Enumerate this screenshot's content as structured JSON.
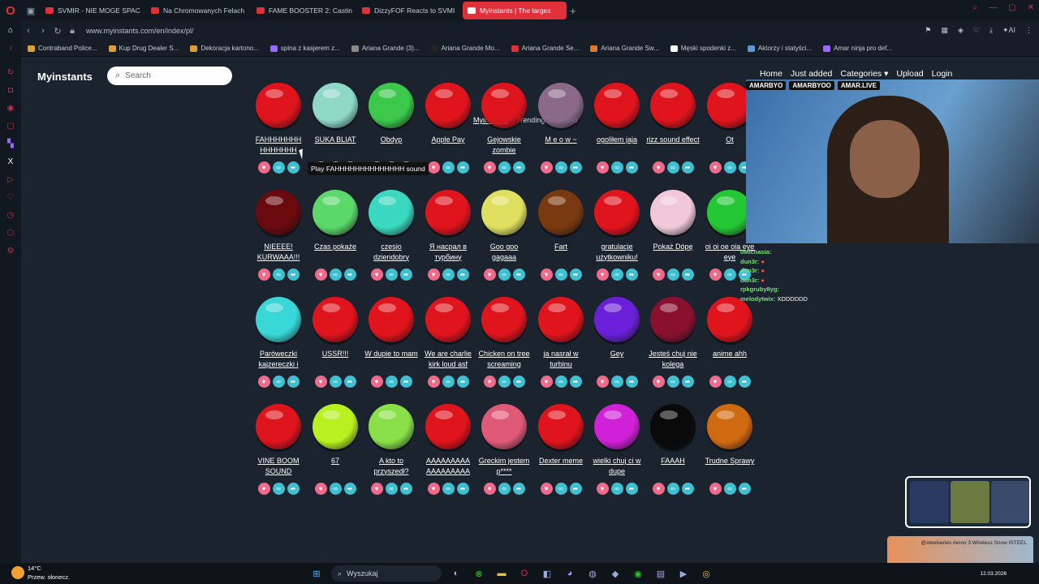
{
  "browser": {
    "tabs": [
      {
        "label": "SVMIR - NIE MOGE SPAC",
        "active": false
      },
      {
        "label": "Na Chromowanych Felach",
        "active": false
      },
      {
        "label": "FAME BOOSTER 2: Castin",
        "active": false
      },
      {
        "label": "DizzyFOF Reacts to SVMI",
        "active": false
      },
      {
        "label": "Myinstants | The larges",
        "active": true
      }
    ],
    "url": "www.myinstants.com/en/index/pl/",
    "bookmarks": [
      "Contraband Police...",
      "Kup Drug Dealer S...",
      "Dekoracja kartono...",
      "spina z kasjerem z...",
      "Ariana Grande (3)...",
      "Ariana Grande Mo...",
      "Ariana Grande Se...",
      "Ariana Grande Sw...",
      "Męski spodenki z...",
      "Aktorzy i statyści...",
      "Amar ninja pro def..."
    ]
  },
  "site": {
    "brand": "Myinstants",
    "search_placeholder": "Search",
    "nav": [
      "Home",
      "Just added",
      "Categories ▾",
      "Upload",
      "Login"
    ],
    "breadcrumb_root": "Myinstants",
    "breadcrumb_sep": ">",
    "breadcrumb_current": "Trending in Poland",
    "tooltip": "Play FAHHHHHHHHHHHHHH sound"
  },
  "sounds": [
    [
      {
        "label": "FAHHHHHHH HHHHHHH",
        "color": "#e0141c"
      },
      {
        "label": "SUKA BLIAT",
        "color": "#8fd8c8"
      },
      {
        "label": "Obdyp",
        "color": "#3cc84a"
      },
      {
        "label": "Apple Pay",
        "color": "#e0141c"
      },
      {
        "label": "Gejowskie zombie",
        "color": "#e0141c"
      },
      {
        "label": "M e o w ~",
        "color": "#8a6a88"
      },
      {
        "label": "ogoliłem jaja",
        "color": "#e0141c"
      },
      {
        "label": "rizz sound effect",
        "color": "#e0141c"
      },
      {
        "label": "Ot",
        "color": "#e0141c"
      }
    ],
    [
      {
        "label": "NIEEEE! KURWAAA!!!",
        "color": "#6a0a0e"
      },
      {
        "label": "Czas pokaże",
        "color": "#5cd86a"
      },
      {
        "label": "czesio dziendobry",
        "color": "#3ad8c0"
      },
      {
        "label": "Я насрал в турбину",
        "color": "#e0141c"
      },
      {
        "label": "Goo goo gagaaa",
        "color": "#e0e060"
      },
      {
        "label": "Fart",
        "color": "#7a3a10"
      },
      {
        "label": "gratulacje użytkowniku!",
        "color": "#e0141c"
      },
      {
        "label": "Pokaż Dópę",
        "color": "#f0c8d8"
      },
      {
        "label": "oi oi oe oia eye eye",
        "color": "#24c834"
      }
    ],
    [
      {
        "label": "Paróweczki kajzereczki i",
        "color": "#38d8d8"
      },
      {
        "label": "USSR!!!",
        "color": "#e0141c"
      },
      {
        "label": "W dupie to mam",
        "color": "#e0141c"
      },
      {
        "label": "We are charlie kirk loud asf",
        "color": "#e0141c"
      },
      {
        "label": "Chicken on tree screaming",
        "color": "#e0141c"
      },
      {
        "label": "ja nasrał w turbinu",
        "color": "#e0141c"
      },
      {
        "label": "Gey",
        "color": "#6a20d8"
      },
      {
        "label": "Jesteś chuj nie kolega",
        "color": "#8a1030"
      },
      {
        "label": "anime ahh",
        "color": "#e0141c"
      }
    ],
    [
      {
        "label": "VINE BOOM SOUND",
        "color": "#e0141c"
      },
      {
        "label": "67",
        "color": "#b8f020"
      },
      {
        "label": "A kto to przyszedł?",
        "color": "#8ae048"
      },
      {
        "label": "AAAAAAAAA AAAAAAAAA",
        "color": "#e0141c"
      },
      {
        "label": "Greckim jestem p****",
        "color": "#e05a78"
      },
      {
        "label": "Dexter meme",
        "color": "#e0141c"
      },
      {
        "label": "wielki chuj ci w dupe",
        "color": "#d020d8"
      },
      {
        "label": "FAAAH",
        "color": "#0a0a0a"
      },
      {
        "label": "Trudne Sprawy",
        "color": "#d06a10"
      }
    ]
  ],
  "stream": {
    "labels": [
      "AMARBYO",
      "AMARBYOO",
      "AMAR.LIVE"
    ],
    "chat": [
      {
        "user": "0Michasia:",
        "msg": ""
      },
      {
        "user": "dun3r:",
        "msg": "",
        "red": true
      },
      {
        "user": "dun3r:",
        "msg": "",
        "red": true
      },
      {
        "user": "dun3r:",
        "msg": "",
        "red": true
      },
      {
        "user": "rpkgruby8yg:",
        "msg": ""
      },
      {
        "user": "melodytwix:",
        "msg": "XDDDDDD"
      }
    ],
    "promo_text": "@steelseries Aerox 3 Wireless Snow ISTEEL"
  },
  "taskbar": {
    "temp": "14°C",
    "weather": "Przew. słonecz.",
    "search": "Wyszukaj",
    "date": "12.03.2026"
  }
}
